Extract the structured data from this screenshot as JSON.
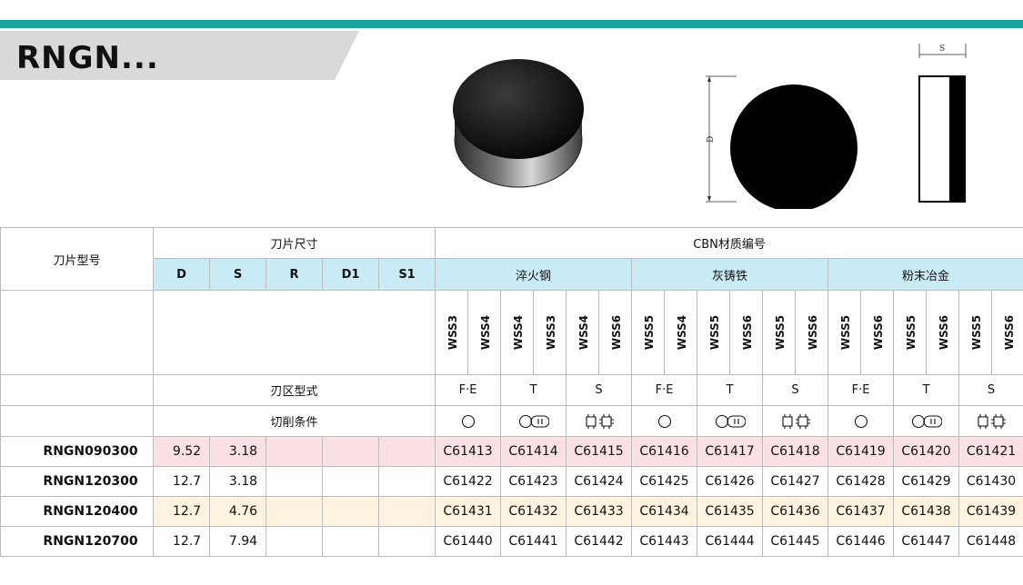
{
  "header": {
    "title": "RNGN..."
  },
  "diagram": {
    "label_d": "D",
    "label_s": "S"
  },
  "table": {
    "col_model": "刀片型号",
    "group_dims": "刀片尺寸",
    "group_cbn": "CBN材质编号",
    "dims": [
      "D",
      "S",
      "R",
      "D1",
      "S1"
    ],
    "materials": [
      "淬火钢",
      "灰铸铁",
      "粉末冶金"
    ],
    "grades": [
      "WSS3",
      "WSS4",
      "WSS4",
      "WSS3",
      "WSS4",
      "WSS6",
      "WSS5",
      "WSS4",
      "WSS5",
      "WSS6",
      "WSS5",
      "WSS6",
      "WSS5",
      "WSS6",
      "WSS5",
      "WSS6",
      "WSS5",
      "WSS6"
    ],
    "edge_label": "刃区型式",
    "edge_types": [
      "F·E",
      "T",
      "S",
      "F·E",
      "T",
      "S",
      "F·E",
      "T",
      "S"
    ],
    "cond_label": "切削条件",
    "rows": [
      {
        "model": "RNGN090300",
        "D": "9.52",
        "S": "3.18",
        "R": "",
        "D1": "",
        "S1": "",
        "codes": [
          "C61413",
          "C61414",
          "C61415",
          "C61416",
          "C61417",
          "C61418",
          "C61419",
          "C61420",
          "C61421"
        ]
      },
      {
        "model": "RNGN120300",
        "D": "12.7",
        "S": "3.18",
        "R": "",
        "D1": "",
        "S1": "",
        "codes": [
          "C61422",
          "C61423",
          "C61424",
          "C61425",
          "C61426",
          "C61427",
          "C61428",
          "C61429",
          "C61430"
        ]
      },
      {
        "model": "RNGN120400",
        "D": "12.7",
        "S": "4.76",
        "R": "",
        "D1": "",
        "S1": "",
        "codes": [
          "C61431",
          "C61432",
          "C61433",
          "C61434",
          "C61435",
          "C61436",
          "C61437",
          "C61438",
          "C61439"
        ]
      },
      {
        "model": "RNGN120700",
        "D": "12.7",
        "S": "7.94",
        "R": "",
        "D1": "",
        "S1": "",
        "codes": [
          "C61440",
          "C61441",
          "C61442",
          "C61443",
          "C61444",
          "C61445",
          "C61446",
          "C61447",
          "C61448"
        ]
      }
    ]
  },
  "colors": {
    "accent": "#1aa39c",
    "header_blue": "#c9ebf6",
    "row_pink": "#fbe0e4",
    "row_cream": "#fdf3df"
  }
}
